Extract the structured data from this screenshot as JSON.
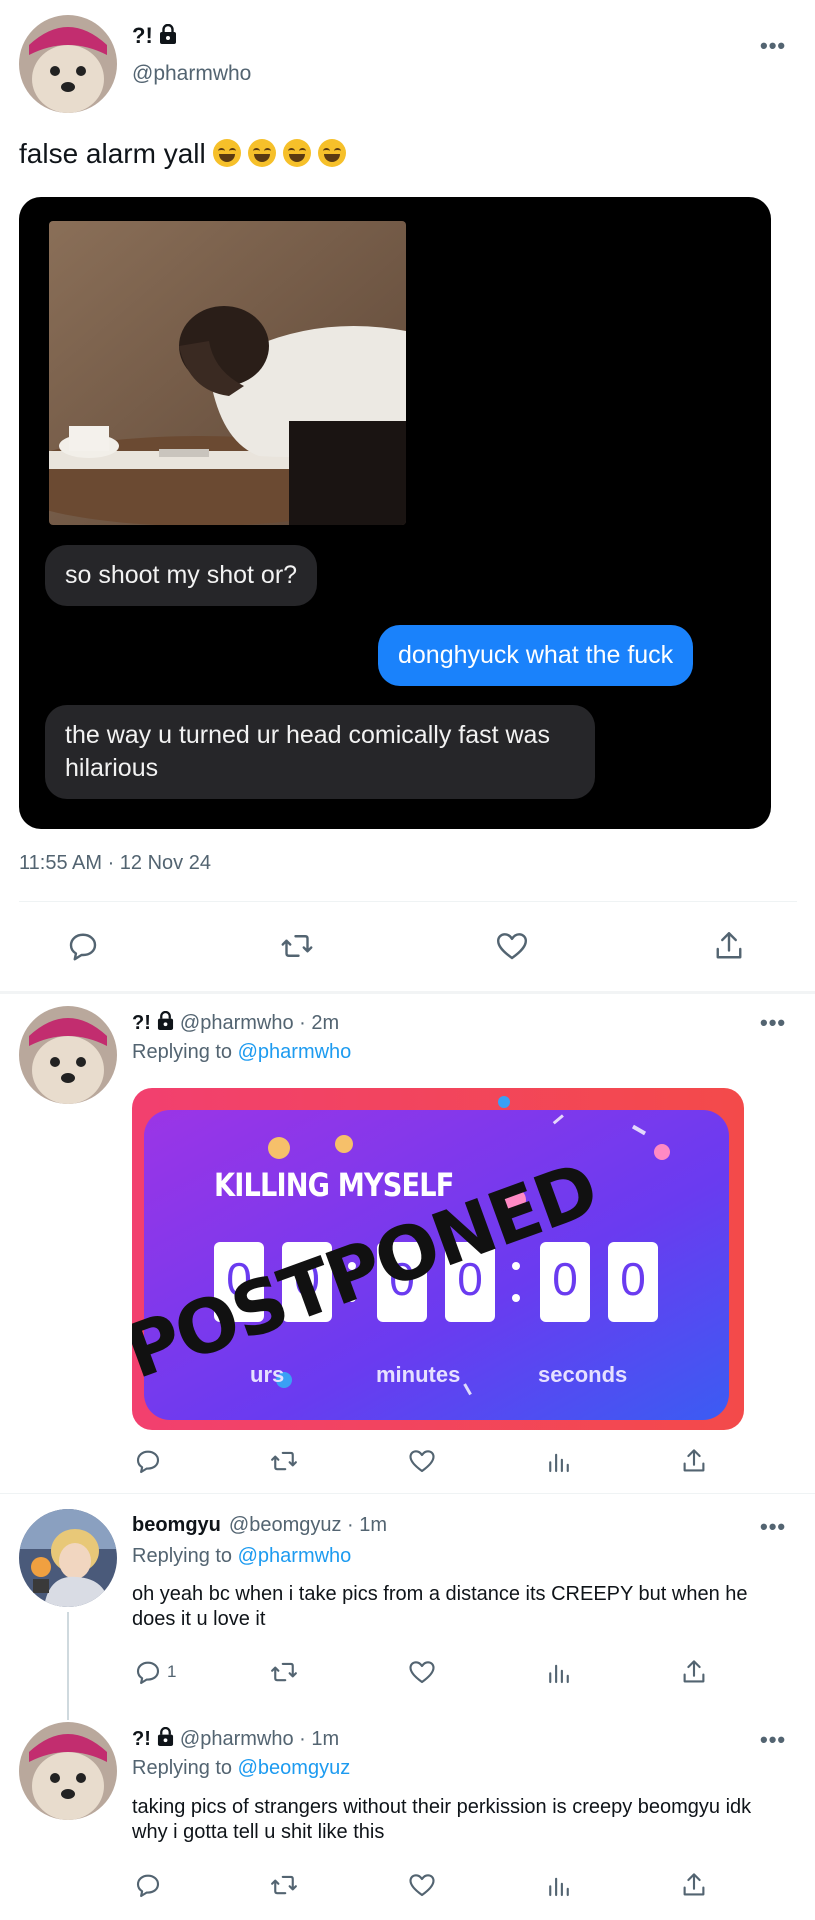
{
  "main_tweet": {
    "name": "?!",
    "handle": "@pharmwho",
    "text": "false alarm yall",
    "emoji_icon": "rolling-on-floor-laughing-emoji",
    "messages": [
      {
        "side": "left",
        "text": "so shoot my shot or?"
      },
      {
        "side": "right",
        "text": "donghyuck what the fuck"
      },
      {
        "side": "left",
        "text": "the way u turned ur head comically fast was hilarious"
      }
    ],
    "timestamp": "11:55 AM · 12 Nov 24"
  },
  "reply1": {
    "name": "?!",
    "handle_time": "@pharmwho · 2m",
    "replying_prefix": "Replying to",
    "replying_to": "@pharmwho",
    "meme": {
      "title": "KILLING MYSELF",
      "digits": [
        "0",
        "0",
        "0",
        "0",
        "0",
        "0"
      ],
      "labels": [
        "urs",
        "minutes",
        "seconds"
      ],
      "stamp": "POSTPONED"
    }
  },
  "reply2": {
    "name": "beomgyu",
    "handle_time": "@beomgyuz · 1m",
    "replying_prefix": "Replying to",
    "replying_to": "@pharmwho",
    "text": "oh yeah bc when i take pics from a distance its CREEPY but when he does it u love it",
    "reply_count": "1"
  },
  "reply3": {
    "name": "?!",
    "handle_time": "@pharmwho · 1m",
    "replying_prefix": "Replying to",
    "replying_to": "@beomgyuz",
    "text": "taking pics of strangers without their perkission is creepy beomgyu idk why i gotta tell u shit like this"
  },
  "icons": {
    "reply": "reply-icon",
    "retweet": "retweet-icon",
    "like": "heart-icon",
    "analytics": "analytics-icon",
    "share": "share-icon",
    "lock": "lock-icon",
    "more": "more-icon"
  },
  "colors": {
    "link": "#1d9bf0",
    "imessage_blue": "#1a82fb",
    "imessage_gray": "#262629"
  }
}
